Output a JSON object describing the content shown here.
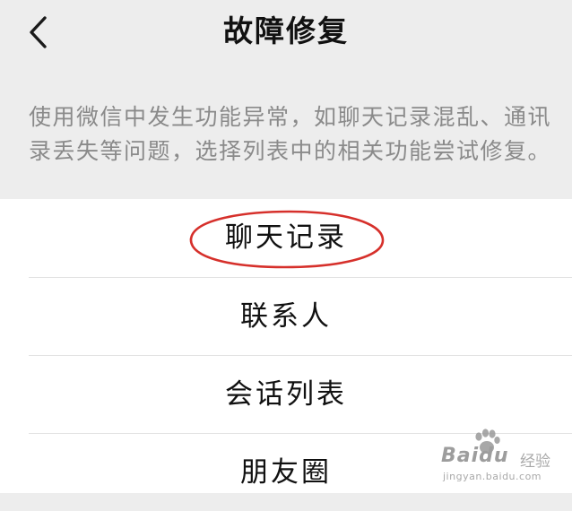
{
  "nav": {
    "back_icon": "chevron-left-icon",
    "title": "故障修复"
  },
  "description": {
    "text": "使用微信中发生功能异常，如聊天记录混乱、通讯录丢失等问题，选择列表中的相关功能尝试修复。"
  },
  "list": {
    "items": [
      {
        "label": "聊天记录"
      },
      {
        "label": "联系人"
      },
      {
        "label": "会话列表"
      },
      {
        "label": "朋友圈"
      }
    ]
  },
  "annotation": {
    "highlight_color": "#d6302b"
  },
  "watermark": {
    "brand": "Baidu",
    "sub": "经验",
    "url": "jingyan.baidu.com"
  }
}
